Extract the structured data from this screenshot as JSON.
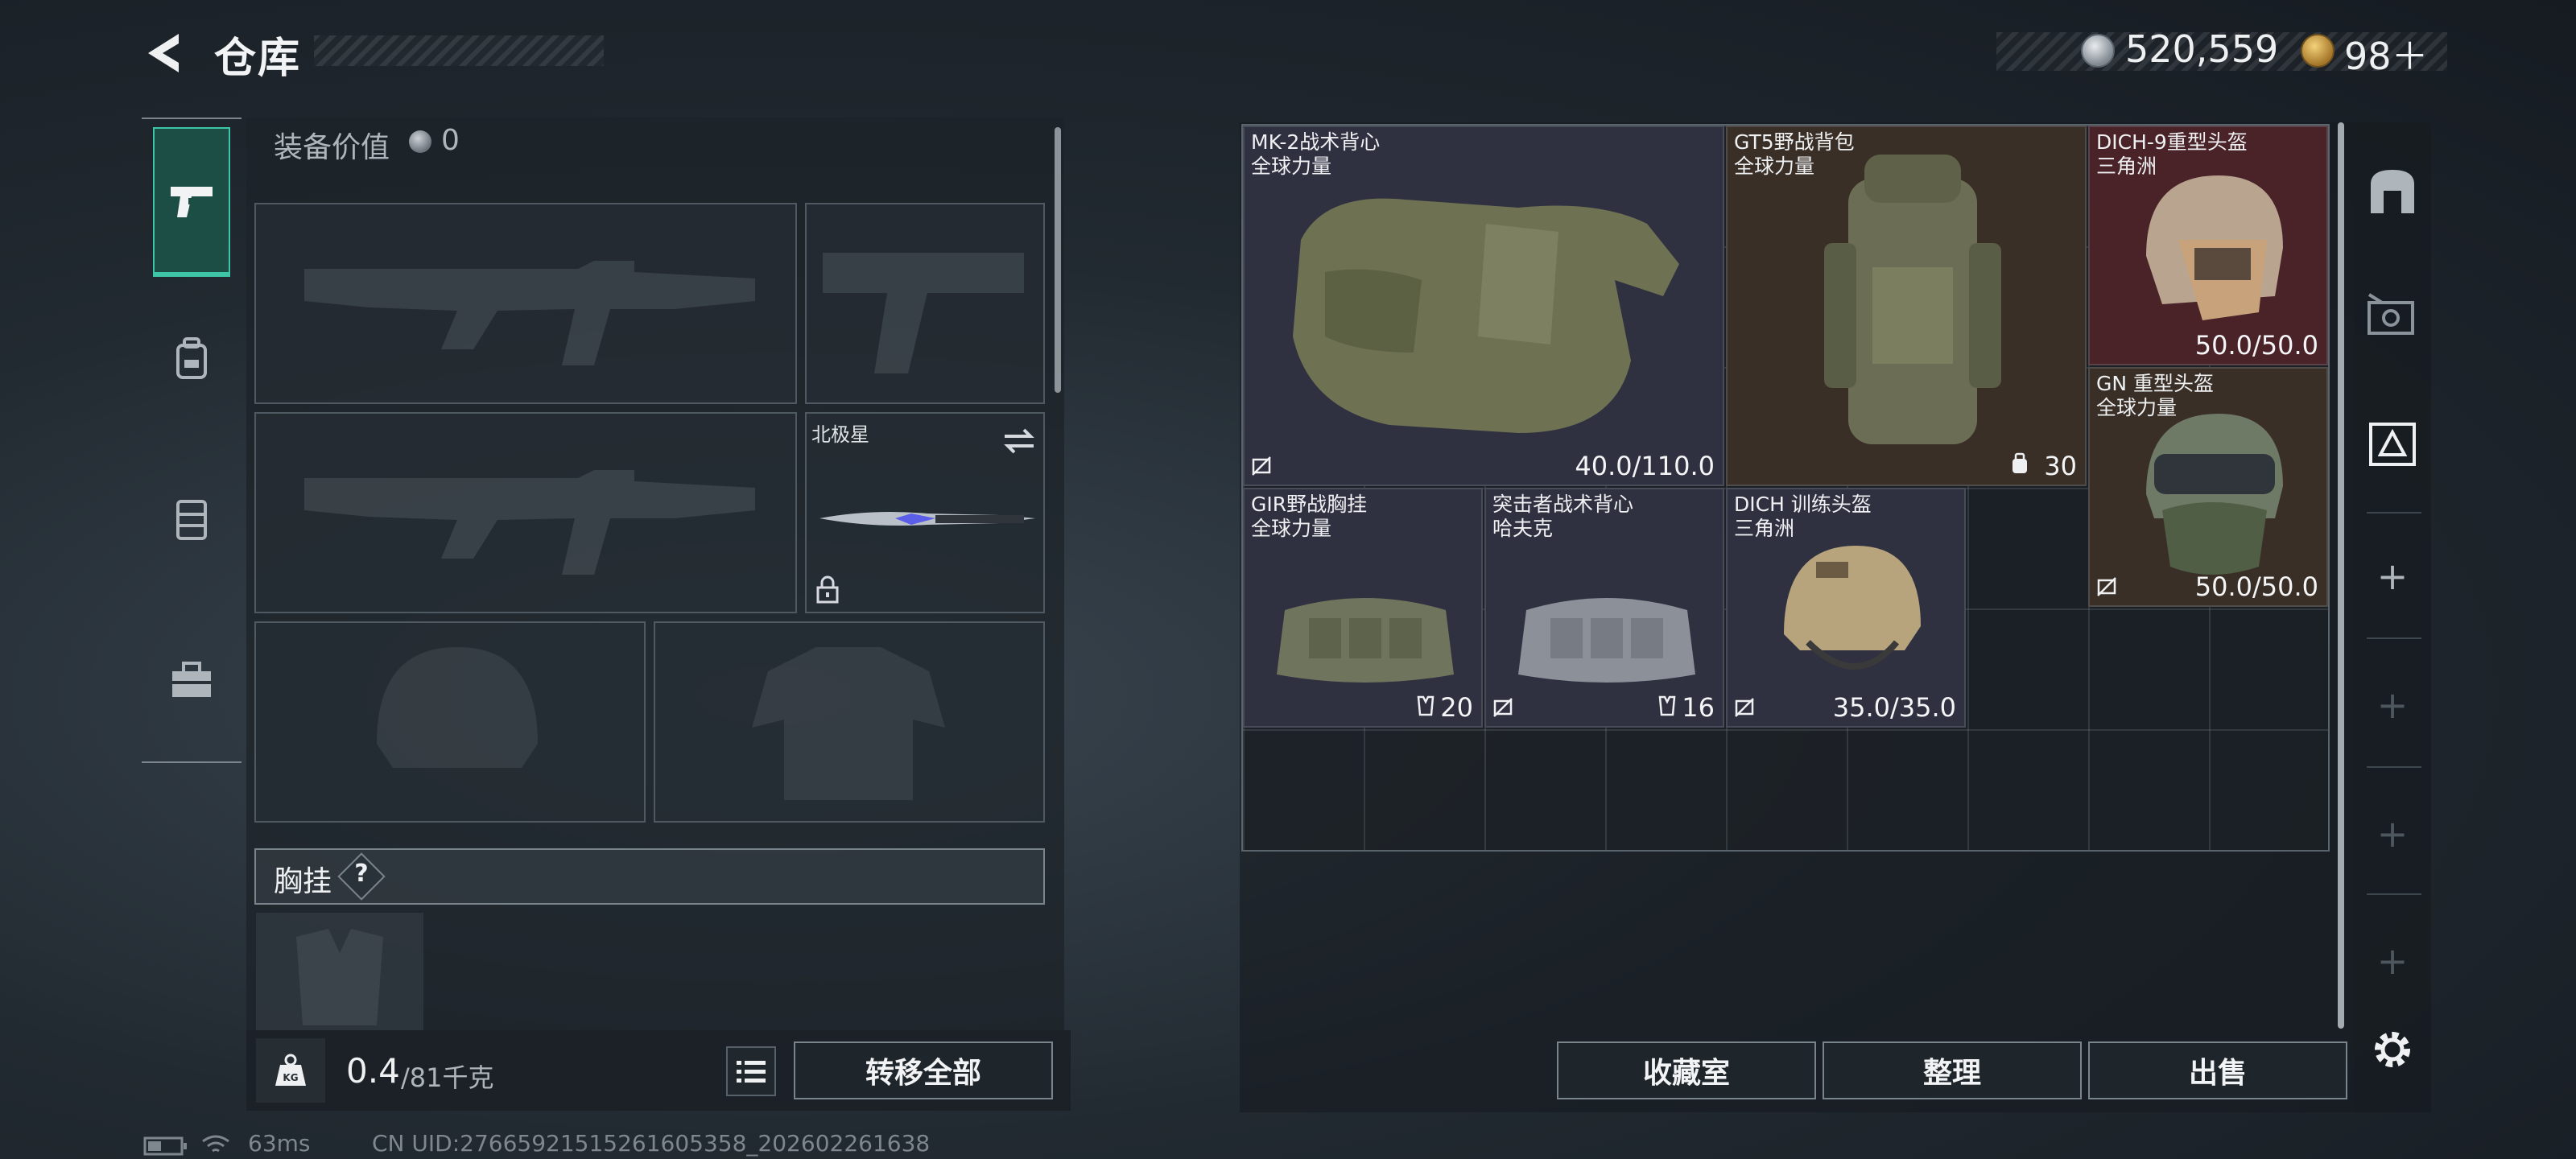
{
  "header": {
    "title": "仓库",
    "coin_value": "520,559",
    "gold_value": "98＋"
  },
  "loadout": {
    "equip_value_label": "装备价值",
    "equip_value": "0",
    "knife_name": "北极星",
    "chest_label": "胸挂",
    "chest_help": "?"
  },
  "weight": {
    "current": "0.4",
    "max": "/81千克",
    "kg": "KG"
  },
  "buttons": {
    "transfer_all": "转移全部",
    "collection": "收藏室",
    "organize": "整理",
    "sell": "出售"
  },
  "stash_items": [
    {
      "name": "MK-2战术背心",
      "brand": "全球力量",
      "stat": "40.0/110.0"
    },
    {
      "name": "GT5野战背包",
      "brand": "全球力量",
      "stat": "30"
    },
    {
      "name": "DICH-9重型头盔",
      "brand": "三角洲",
      "stat": "50.0/50.0"
    },
    {
      "name": "GN 重型头盔",
      "brand": "全球力量",
      "stat": "50.0/50.0"
    },
    {
      "name": "GIR野战胸挂",
      "brand": "全球力量",
      "stat": "20"
    },
    {
      "name": "突击者战术背心",
      "brand": "哈夫克",
      "stat": "16"
    },
    {
      "name": "DICH 训练头盔",
      "brand": "三角洲",
      "stat": "35.0/35.0"
    }
  ],
  "status": {
    "ping": "63ms",
    "uid": "CN UID:27665921515261605358_202602261638"
  },
  "colors": {
    "accent": "#3ec4a6",
    "vest_bg": "#2f3040",
    "backpack_bg": "#3a2f27",
    "heavy_helmet_bg": "#4a2329"
  }
}
